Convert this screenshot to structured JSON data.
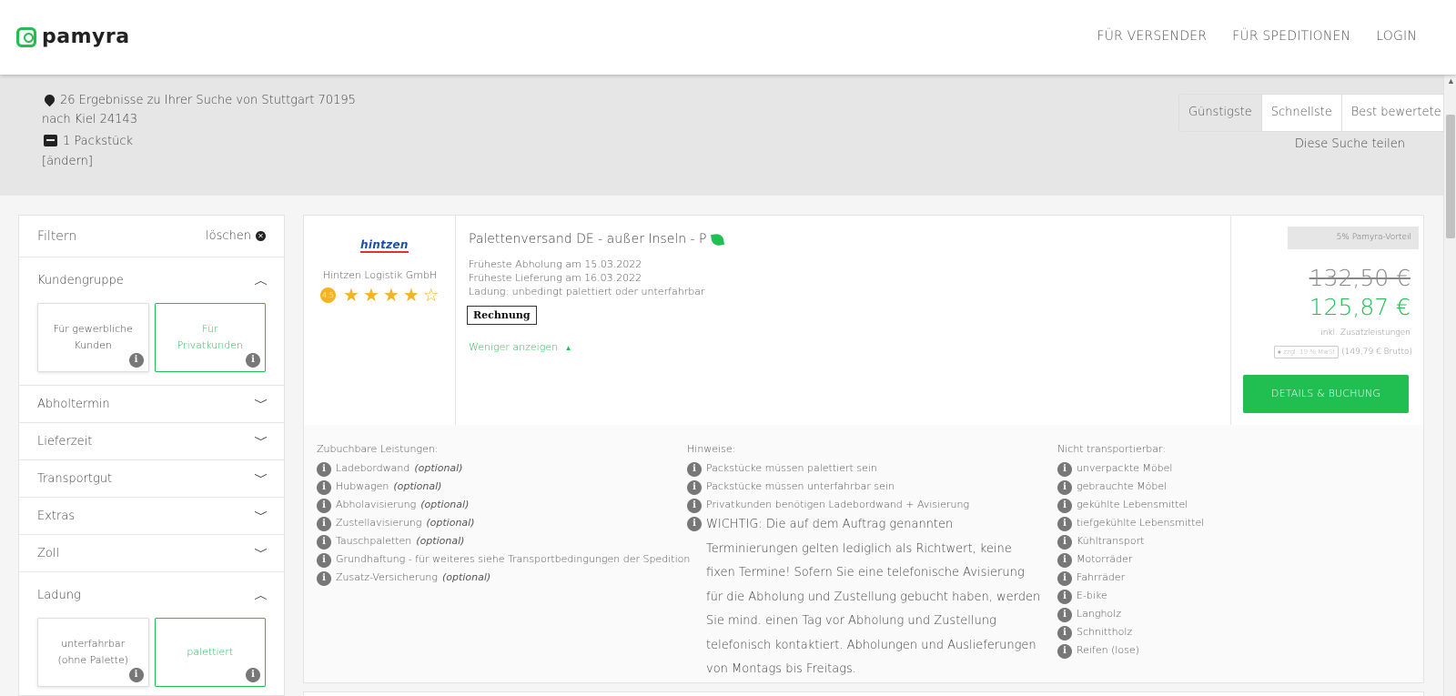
{
  "header": {
    "logo_text": "pamyra",
    "nav": [
      "FÜR VERSENDER",
      "FÜR SPEDITIONEN",
      "LOGIN"
    ]
  },
  "search": {
    "results_line": "26 Ergebnisse zu Ihrer Suche von Stuttgart 70195",
    "destination_line": "nach Kiel 24143",
    "packages": "1 Packstück",
    "change_link": "[ändern]",
    "sort_options": [
      "Günstigste",
      "Schnellste",
      "Best bewertete"
    ],
    "sort_selected": "Günstigste",
    "share": "Diese Suche teilen"
  },
  "filter": {
    "title": "Filtern",
    "clear": "löschen",
    "customer_group": {
      "label": "Kundengruppe",
      "options": [
        "Für gewerbliche Kunden",
        "Für Privatkunden"
      ],
      "selected": "Für Privatkunden"
    },
    "sections": [
      "Abholtermin",
      "Lieferzeit",
      "Transportgut",
      "Extras",
      "Zoll"
    ],
    "load": {
      "label": "Ladung",
      "options": [
        "unterfahrbar (ohne Palette)",
        "palettiert"
      ],
      "selected": "palettiert"
    }
  },
  "result": {
    "company_logo": "hintzen",
    "company_name": "Hintzen Logistik GmbH",
    "rating_badge": "4.5",
    "stars": 4,
    "title": "Palettenversand DE - außer Inseln - P",
    "pickup": "Früheste Abholung am 15.03.2022",
    "delivery": "Früheste Lieferung am 16.03.2022",
    "load": "Ladung: unbedingt palettiert oder unterfahrbar",
    "payment": "Rechnung",
    "show_less": "Weniger anzeigen",
    "promo": "5% Pamyra-Vorteil",
    "old_price": "132,50 €",
    "new_price": "125,87 €",
    "price_note": "inkl. Zusatzleistungen",
    "vat_tag": "zzgl. 19 % MwSt",
    "gross": "(149,79 € Brutto)",
    "book_button": "DETAILS & BUCHUNG",
    "services_heading": "Zubuchbare Leistungen:",
    "services": [
      {
        "text": "Ladebordwand",
        "note": "(optional)"
      },
      {
        "text": "Hubwagen",
        "note": "(optional)"
      },
      {
        "text": "Abholavisierung",
        "note": "(optional)"
      },
      {
        "text": "Zustellavisierung",
        "note": "(optional)"
      },
      {
        "text": "Tauschpaletten",
        "note": "(optional)"
      },
      {
        "text": "Grundhaftung - für weiteres siehe Transportbedingungen der Spedition",
        "note": ""
      },
      {
        "text": "Zusatz-Versicherung",
        "note": "(optional)"
      }
    ],
    "notes_heading": "Hinweise:",
    "notes": [
      "Packstücke müssen palettiert sein",
      "Packstücke müssen unterfahrbar sein",
      "Privatkunden benötigen Ladebordwand + Avisierung"
    ],
    "warning": "WICHTIG: Die auf dem Auftrag genannten Terminierungen gelten lediglich als Richtwert, keine fixen Termine! Sofern Sie eine telefonische Avisierung für die Abholung und Zustellung gebucht haben, werden Sie mind. einen Tag vor Abholung und Zustellung telefonisch kontaktiert. Abholungen und Auslieferungen von Montags bis Freitags.",
    "excluded_heading": "Nicht transportierbar:",
    "excluded": [
      "unverpackte Möbel",
      "gebrauchte Möbel",
      "gekühlte Lebensmittel",
      "tiefgekühlte Lebensmittel",
      "Kühltransport",
      "Motorräder",
      "Fahrräder",
      "E-bike",
      "Langholz",
      "Schnittholz",
      "Reifen (lose)"
    ]
  },
  "colors": {
    "accent": "#21bf52",
    "star": "#f5b323",
    "band": "#e6e6e6"
  }
}
